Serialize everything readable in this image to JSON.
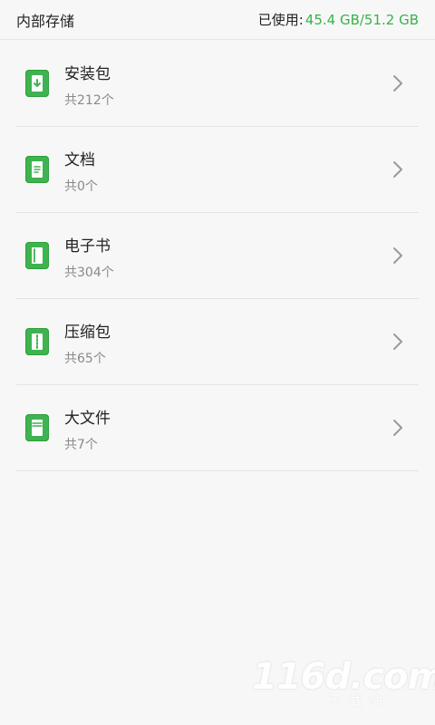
{
  "header": {
    "title": "内部存储",
    "usage_label": "已使用:",
    "usage_value": "45.4 GB/51.2 GB",
    "accent": "#36b34a"
  },
  "items": [
    {
      "title": "安装包",
      "count": "共212个",
      "icon": "package-icon"
    },
    {
      "title": "文档",
      "count": "共0个",
      "icon": "document-icon"
    },
    {
      "title": "电子书",
      "count": "共304个",
      "icon": "ebook-icon"
    },
    {
      "title": "压缩包",
      "count": "共65个",
      "icon": "zip-icon"
    },
    {
      "title": "大文件",
      "count": "共7个",
      "icon": "large-file-icon"
    }
  ],
  "watermark": {
    "main": "116d.com",
    "sub": "下载站"
  }
}
